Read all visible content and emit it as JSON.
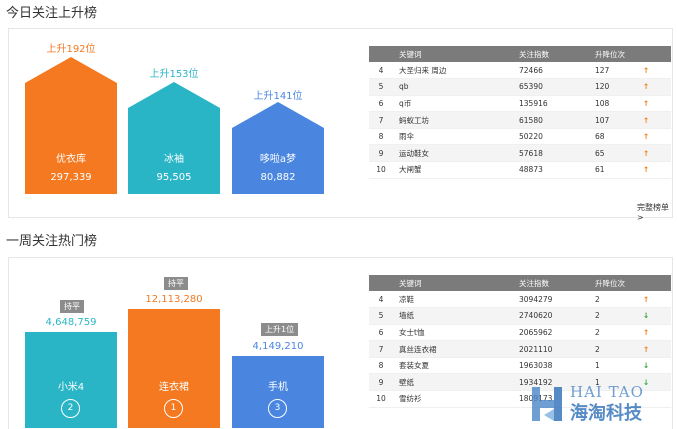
{
  "top": {
    "title": "今日关注上升榜",
    "bars": [
      {
        "rank_text": "上升192位",
        "name": "优衣库",
        "value": "297,339",
        "color": "#f47920"
      },
      {
        "rank_text": "上升153位",
        "name": "冰袖",
        "value": "95,505",
        "color": "#2ab5c6"
      },
      {
        "rank_text": "上升141位",
        "name": "哆啦a梦",
        "value": "80,882",
        "color": "#4a86e0"
      }
    ],
    "table": {
      "headers": [
        "",
        "关键词",
        "关注指数",
        "升降位次",
        ""
      ],
      "rows": [
        {
          "idx": "4",
          "keyword": "大圣归来 周边",
          "index": "72466",
          "change": "127",
          "arrow": "↑"
        },
        {
          "idx": "5",
          "keyword": "qb",
          "index": "65390",
          "change": "120",
          "arrow": "↑"
        },
        {
          "idx": "6",
          "keyword": "q币",
          "index": "135916",
          "change": "108",
          "arrow": "↑"
        },
        {
          "idx": "7",
          "keyword": "蚂蚁工坊",
          "index": "61580",
          "change": "107",
          "arrow": "↑"
        },
        {
          "idx": "8",
          "keyword": "雨伞",
          "index": "50220",
          "change": "68",
          "arrow": "↑"
        },
        {
          "idx": "9",
          "keyword": "运动鞋女",
          "index": "57618",
          "change": "65",
          "arrow": "↑"
        },
        {
          "idx": "10",
          "keyword": "大闸蟹",
          "index": "48873",
          "change": "61",
          "arrow": "↑"
        }
      ]
    },
    "more_link": "完整榜单>"
  },
  "bottom": {
    "title": "一周关注热门榜",
    "bars": [
      {
        "tag": "持平",
        "value": "4,648,759",
        "name": "小米4",
        "rank": "2",
        "color": "#2ab5c6"
      },
      {
        "tag": "持平",
        "value": "12,113,280",
        "name": "连衣裙",
        "rank": "1",
        "color": "#f47920"
      },
      {
        "tag": "上升1位",
        "value": "4,149,210",
        "name": "手机",
        "rank": "3",
        "color": "#4a86e0"
      }
    ],
    "table": {
      "headers": [
        "",
        "关键词",
        "关注指数",
        "升降位次",
        ""
      ],
      "rows": [
        {
          "idx": "4",
          "keyword": "凉鞋",
          "index": "3094279",
          "change": "2",
          "arrow": "↑",
          "dir": "up"
        },
        {
          "idx": "5",
          "keyword": "墙纸",
          "index": "2740620",
          "change": "2",
          "arrow": "↓",
          "dir": "down"
        },
        {
          "idx": "6",
          "keyword": "女士t恤",
          "index": "2065962",
          "change": "2",
          "arrow": "↑",
          "dir": "up"
        },
        {
          "idx": "7",
          "keyword": "真丝连衣裙",
          "index": "2021110",
          "change": "2",
          "arrow": "↑",
          "dir": "up"
        },
        {
          "idx": "8",
          "keyword": "套装女夏",
          "index": "1963038",
          "change": "1",
          "arrow": "↓",
          "dir": "down"
        },
        {
          "idx": "9",
          "keyword": "壁纸",
          "index": "1934192",
          "change": "1",
          "arrow": "↓",
          "dir": "down"
        },
        {
          "idx": "10",
          "keyword": "雪纺衫",
          "index": "1809173",
          "change": "",
          "arrow": "",
          "dir": "none"
        }
      ]
    }
  },
  "watermark": {
    "en": "HAI TAO",
    "cn": "海淘科技"
  }
}
